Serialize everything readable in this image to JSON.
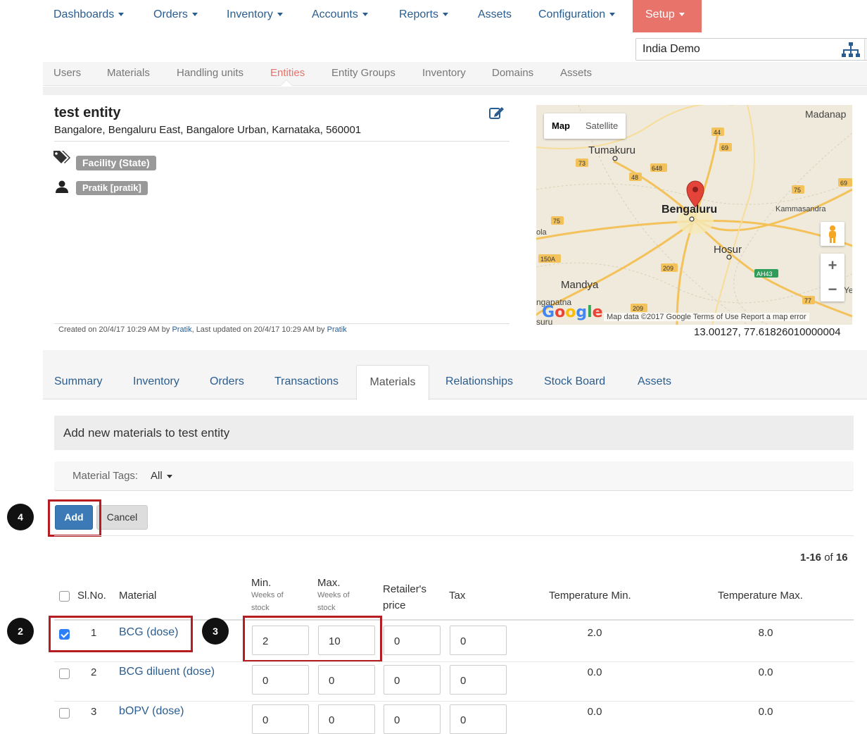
{
  "nav": {
    "items": [
      {
        "label": "Dashboards",
        "caret": true
      },
      {
        "label": "Orders",
        "caret": true
      },
      {
        "label": "Inventory",
        "caret": true
      },
      {
        "label": "Accounts",
        "caret": true
      },
      {
        "label": "Reports",
        "caret": true
      },
      {
        "label": "Assets",
        "caret": false
      },
      {
        "label": "Configuration",
        "caret": true
      }
    ],
    "setup": "Setup",
    "accent": "#e8736a"
  },
  "domain": {
    "value": "India Demo"
  },
  "subnav": {
    "items": [
      "Users",
      "Materials",
      "Handling units",
      "Entities",
      "Entity Groups",
      "Inventory",
      "Domains",
      "Assets"
    ],
    "active": "Entities"
  },
  "entity": {
    "name": "test entity",
    "address": "Bangalore, Bengaluru East, Bangalore Urban, Karnataka, 560001",
    "tag": "Facility (State)",
    "user": "Pratik [pratik]",
    "created_prefix": "Created on 20/4/17 10:29 AM by ",
    "created_by": "Pratik",
    "updated_prefix": ", Last updated on 20/4/17 10:29 AM by ",
    "updated_by": "Pratik"
  },
  "map": {
    "toggle_map": "Map",
    "toggle_satellite": "Satellite",
    "places": [
      "Madanap",
      "Tumakuru",
      "Bengaluru",
      "Kammasandra",
      "Hosur",
      "Mandya",
      "ola",
      "ngapatna",
      "suru",
      "Ye"
    ],
    "road_labels": [
      "44",
      "69",
      "73",
      "648",
      "48",
      "75",
      "69",
      "75",
      "150A",
      "209",
      "AH43",
      "77",
      "209"
    ],
    "logo": "Google",
    "footer": "Map data ©2017 Google   Terms of Use   Report a map error",
    "zoom_in": "+",
    "zoom_out": "−",
    "coords": "13.00127, 77.61826010000004"
  },
  "tabs": {
    "items": [
      "Summary",
      "Inventory",
      "Orders",
      "Transactions",
      "Materials",
      "Relationships",
      "Stock Board",
      "Assets"
    ],
    "active": "Materials"
  },
  "panel": {
    "title": "Add new materials to test entity"
  },
  "filter": {
    "label": "Material Tags:",
    "value": "All"
  },
  "actions": {
    "add": "Add",
    "cancel": "Cancel"
  },
  "callouts": {
    "c2": "2",
    "c3": "3",
    "c4": "4"
  },
  "pager": {
    "range": "1-16",
    "of": "of",
    "total": "16"
  },
  "table": {
    "headers": {
      "slno": "Sl.No.",
      "material": "Material",
      "min": "Min.",
      "min_sub1": "Weeks of",
      "min_sub2": "stock",
      "max": "Max.",
      "max_sub1": "Weeks of",
      "max_sub2": "stock",
      "retailer1": "Retailer's",
      "retailer2": "price",
      "tax": "Tax",
      "tmin": "Temperature Min.",
      "tmax": "Temperature Max."
    },
    "rows": [
      {
        "sl": "1",
        "material": "BCG (dose)",
        "checked": true,
        "min": "2",
        "max": "10",
        "price": "0",
        "tax": "0",
        "tmin": "2.0",
        "tmax": "8.0"
      },
      {
        "sl": "2",
        "material": "BCG diluent (dose)",
        "checked": false,
        "min": "0",
        "max": "0",
        "price": "0",
        "tax": "0",
        "tmin": "0.0",
        "tmax": "0.0"
      },
      {
        "sl": "3",
        "material": "bOPV (dose)",
        "checked": false,
        "min": "0",
        "max": "0",
        "price": "0",
        "tax": "0",
        "tmin": "0.0",
        "tmax": "0.0"
      }
    ]
  }
}
